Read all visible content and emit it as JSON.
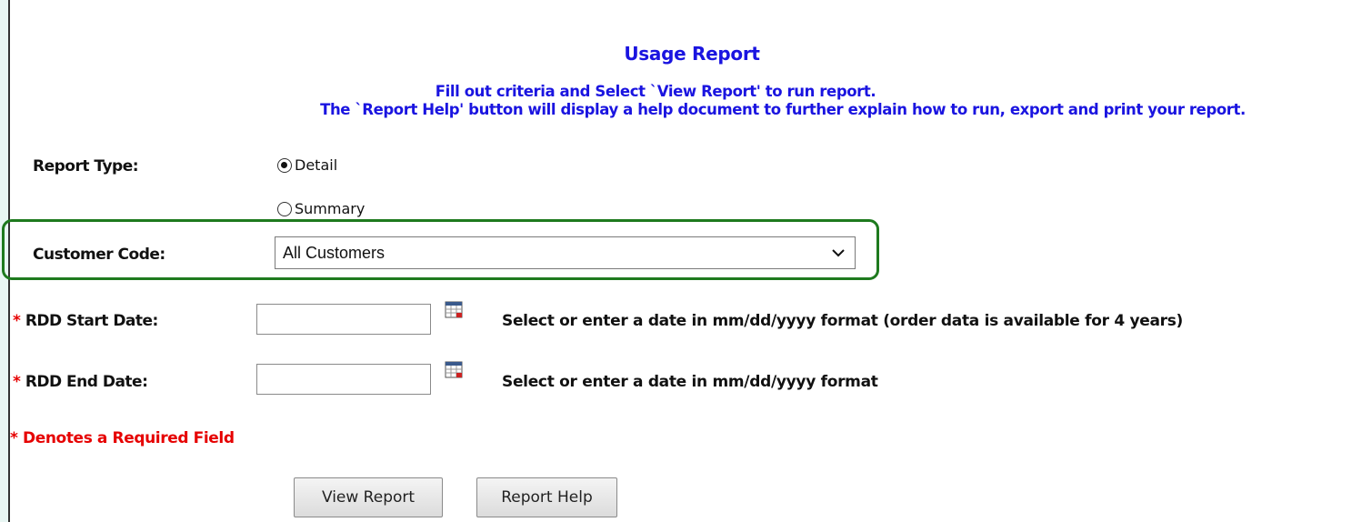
{
  "report": {
    "title": "Usage Report",
    "instruction_line1": "Fill out criteria and Select `View Report' to run report.",
    "instruction_line2": "The `Report Help' button will display a help document to further explain how to run, export and print your report."
  },
  "report_type": {
    "label": "Report Type:",
    "options": [
      {
        "label": "Detail",
        "selected": true
      },
      {
        "label": "Summary",
        "selected": false
      }
    ]
  },
  "customer_code": {
    "label": "Customer Code:",
    "selected_value": "All Customers"
  },
  "rdd_start": {
    "asterisk": "*",
    "label": "RDD Start Date:",
    "value": "",
    "hint": "Select or enter a date in mm/dd/yyyy format (order data is available for 4 years)"
  },
  "rdd_end": {
    "asterisk": "*",
    "label": "RDD End Date:",
    "value": "",
    "hint": "Select or enter a date in mm/dd/yyyy format"
  },
  "required_note": "* Denotes a Required Field",
  "buttons": {
    "view_report": "View Report",
    "report_help": "Report Help"
  },
  "colors": {
    "heading_blue": "#1a14e0",
    "required_red": "#e60000",
    "highlight_green": "#1e7a1e",
    "page_background": "#e8f6f3"
  },
  "icons": {
    "select_chevron": "chevron-down-icon",
    "date_picker": "calendar-icon"
  }
}
